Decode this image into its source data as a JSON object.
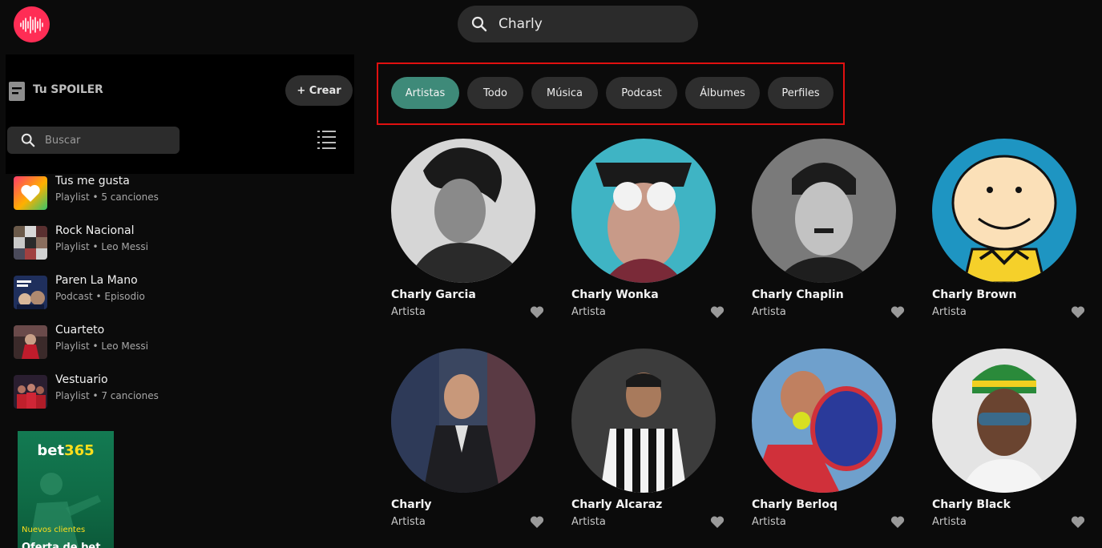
{
  "search": {
    "query": "Charly"
  },
  "library": {
    "title": "Tu SPOILER",
    "create_label": "+ Crear",
    "search_placeholder": "Buscar",
    "items": [
      {
        "name": "Tus me gusta",
        "subtitle": "Playlist • 5 canciones"
      },
      {
        "name": "Rock Nacional",
        "subtitle": "Playlist • Leo Messi"
      },
      {
        "name": "Paren La Mano",
        "subtitle": "Podcast • Episodio"
      },
      {
        "name": "Cuarteto",
        "subtitle": "Playlist • Leo Messi"
      },
      {
        "name": "Vestuario",
        "subtitle": "Playlist • 7 canciones"
      }
    ]
  },
  "ad": {
    "brand_a": "bet",
    "brand_b": "365",
    "subtitle": "Nuevos clientes",
    "extra": "Oferta de bet..."
  },
  "filters": [
    {
      "label": "Artistas",
      "active": true
    },
    {
      "label": "Todo"
    },
    {
      "label": "Música"
    },
    {
      "label": "Podcast"
    },
    {
      "label": "Álbumes"
    },
    {
      "label": "Perfiles"
    }
  ],
  "results": [
    {
      "name": "Charly Garcia",
      "type": "Artista"
    },
    {
      "name": "Charly Wonka",
      "type": "Artista"
    },
    {
      "name": "Charly Chaplin",
      "type": "Artista"
    },
    {
      "name": "Charly Brown",
      "type": "Artista"
    },
    {
      "name": "Charly",
      "type": "Artista"
    },
    {
      "name": "Charly Alcaraz",
      "type": "Artista"
    },
    {
      "name": "Charly Berloq",
      "type": "Artista"
    },
    {
      "name": "Charly Black",
      "type": "Artista"
    }
  ],
  "colors": {
    "accent": "#3e8a79",
    "brand": "#ff2d55",
    "highlight_box": "#e01010"
  }
}
